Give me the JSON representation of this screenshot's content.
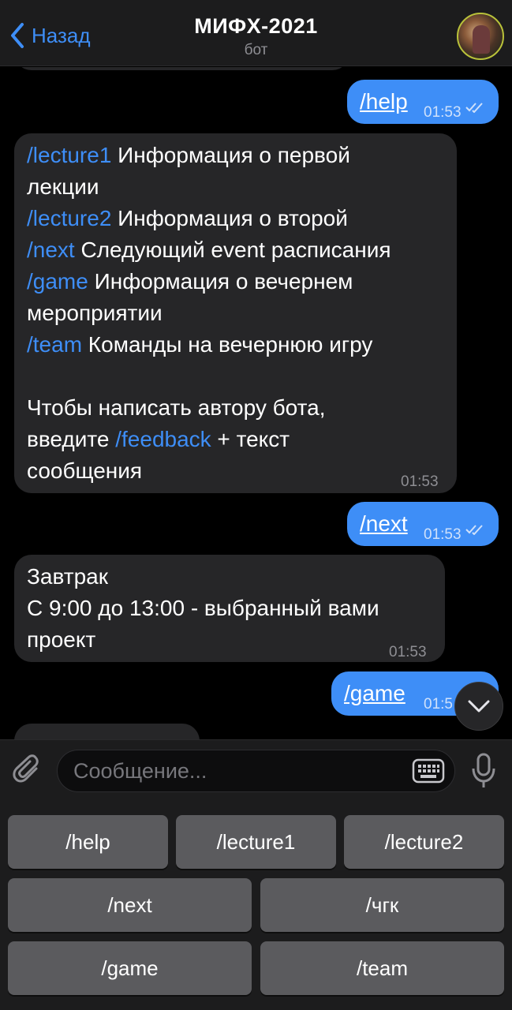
{
  "header": {
    "back_label": "Назад",
    "title": "МИФХ-2021",
    "subtitle": "бот"
  },
  "messages": [
    {
      "dir": "out",
      "command": "/help",
      "time": "01:53"
    },
    {
      "dir": "in",
      "time": "01:53",
      "lines": [
        {
          "cmd": "/lecture1",
          "text": " Информация о первой"
        },
        {
          "cmd": "",
          "text": "лекции"
        },
        {
          "cmd": "/lecture2",
          "text": " Информация о второй"
        },
        {
          "cmd": "/next",
          "text": " Следующий event расписания"
        },
        {
          "cmd": "/game",
          "text": " Информация о вечернем"
        },
        {
          "cmd": "",
          "text": "мероприятии"
        },
        {
          "cmd": "/team",
          "text": " Команды на вечернюю игру"
        },
        {
          "cmd": "",
          "text": ""
        },
        {
          "cmd": "",
          "text": "Чтобы написать автору бота,"
        },
        {
          "pre": "введите ",
          "cmd": "/feedback",
          "text": " + текст"
        },
        {
          "cmd": "",
          "text": "сообщения"
        }
      ]
    },
    {
      "dir": "out",
      "command": "/next",
      "time": "01:53"
    },
    {
      "dir": "in",
      "time": "01:53",
      "lines": [
        {
          "cmd": "",
          "text": "Завтрак"
        },
        {
          "cmd": "",
          "text": "С 9:00 до 13:00 - выбранный вами"
        },
        {
          "cmd": "",
          "text": "проект"
        }
      ]
    },
    {
      "dir": "out",
      "command": "/game",
      "time": "01:5"
    }
  ],
  "input": {
    "placeholder": "Сообщение..."
  },
  "keyboard": {
    "rows": [
      [
        "/help",
        "/lecture1",
        "/lecture2"
      ],
      [
        "/next",
        "/чгк"
      ],
      [
        "/game",
        "/team"
      ]
    ]
  },
  "colors": {
    "accent": "#3e8ef7",
    "bubble_in": "#262628",
    "bubble_out": "#3e8ef7",
    "background": "#000000",
    "key": "#5b5b5e"
  }
}
